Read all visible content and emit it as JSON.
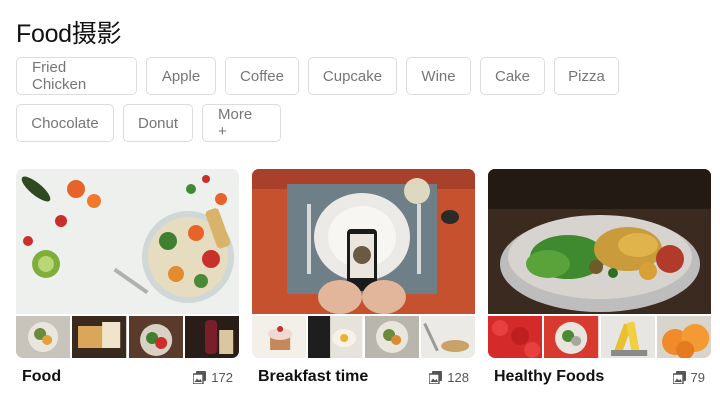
{
  "page": {
    "title": "Food摄影"
  },
  "tags": [
    "Fried Chicken",
    "Apple",
    "Coffee",
    "Cupcake",
    "Wine",
    "Cake",
    "Pizza",
    "Chocolate",
    "Donut",
    "More +"
  ],
  "collections": [
    {
      "title": "Food",
      "count": "172"
    },
    {
      "title": "Breakfast time",
      "count": "128"
    },
    {
      "title": "Healthy Foods",
      "count": "79"
    }
  ],
  "colors": {
    "tag_border": "#dcdcdc",
    "tag_text": "#767676",
    "title": "#111111"
  },
  "icons": {
    "photo_count": "photos-icon"
  }
}
